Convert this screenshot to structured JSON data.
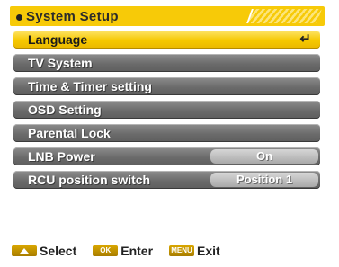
{
  "header": {
    "title": "System Setup"
  },
  "menu": {
    "items": [
      {
        "label": "Language",
        "selected": true,
        "enter_icon": "↵"
      },
      {
        "label": "TV System"
      },
      {
        "label": "Time & Timer setting"
      },
      {
        "label": "OSD Setting"
      },
      {
        "label": "Parental Lock"
      },
      {
        "label": "LNB Power",
        "value": "On"
      },
      {
        "label": "RCU position switch",
        "value": "Position 1"
      }
    ]
  },
  "footer": {
    "select_label": "Select",
    "enter_label": "Enter",
    "exit_label": "Exit",
    "ok_key": "OK",
    "menu_key": "MENU"
  },
  "colors": {
    "accent": "#f7ca08",
    "item_bg": "#6b6b6b"
  }
}
